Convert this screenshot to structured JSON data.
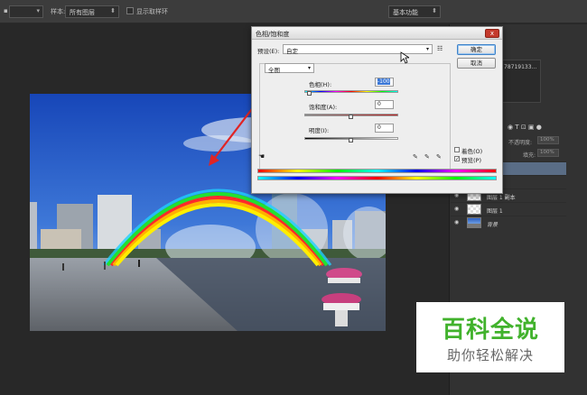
{
  "options_bar": {
    "sample_label": "样本:",
    "sample_value": "所有图层",
    "show_ring_label": "显示取样环",
    "workspace_value": "基本功能"
  },
  "dialog": {
    "title": "色相/饱和度",
    "close_label": "x",
    "preset_label": "预设(E):",
    "preset_value": "自定",
    "ok_label": "确定",
    "cancel_label": "取消",
    "channel_value": "全图",
    "hue_label": "色相(H):",
    "hue_value": "-100",
    "saturation_label": "饱和度(A):",
    "saturation_value": "0",
    "lightness_label": "明度(I):",
    "lightness_value": "0",
    "colorize_label": "着色(O)",
    "preview_label": "预览(P)",
    "preview_checked": true,
    "colorize_checked": false,
    "hue_slider_fraction": 0.0556,
    "saturation_slider_fraction": 0.5,
    "lightness_slider_fraction": 0.5
  },
  "panels": {
    "truncated_value": "78719133...",
    "opacity_label": "不透明度:",
    "opacity_value": "100%",
    "fill_label": "填充:",
    "fill_value": "100%",
    "layers": [
      {
        "name": "副本 3",
        "selected": true,
        "thumb": "checker"
      },
      {
        "name": "副本 2",
        "selected": false,
        "thumb": "checker"
      },
      {
        "name": "图层 1 副本",
        "selected": false,
        "thumb": "checker"
      },
      {
        "name": "图层 1",
        "selected": false,
        "thumb": "checker"
      },
      {
        "name": "背景",
        "selected": false,
        "thumb": "image"
      }
    ]
  },
  "watermark": {
    "main": "百科全说",
    "sub": "助你轻松解决"
  },
  "colors": {
    "accent_blue": "#3a77d6",
    "close_red": "#c43a2c",
    "watermark_green": "#41b22c",
    "selected_layer": "#5a6d86"
  }
}
